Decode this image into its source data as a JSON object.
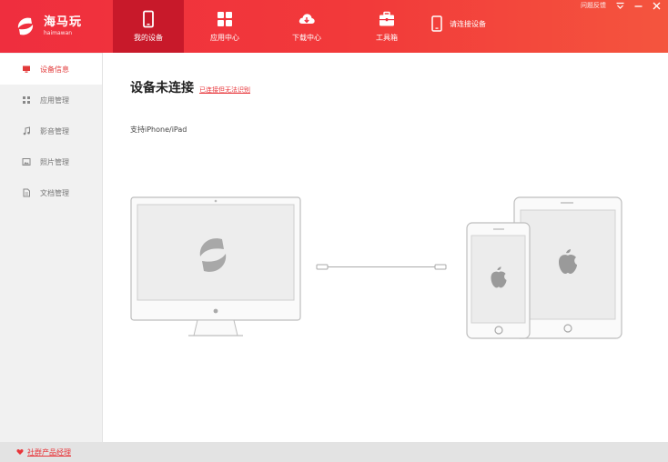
{
  "app": {
    "name": "海马玩",
    "subtitle": "haimawan"
  },
  "nav": {
    "tabs": [
      {
        "label": "我的设备",
        "icon": "phone-icon"
      },
      {
        "label": "应用中心",
        "icon": "grid-icon"
      },
      {
        "label": "下载中心",
        "icon": "cloud-download-icon"
      },
      {
        "label": "工具箱",
        "icon": "toolbox-icon"
      }
    ],
    "connect_label": "请连接设备"
  },
  "window": {
    "feedback_label": "问题反馈"
  },
  "sidebar": {
    "items": [
      {
        "label": "设备信息",
        "icon": "device-info-icon"
      },
      {
        "label": "应用管理",
        "icon": "app-grid-icon"
      },
      {
        "label": "影音管理",
        "icon": "music-note-icon"
      },
      {
        "label": "照片管理",
        "icon": "photo-icon"
      },
      {
        "label": "文档管理",
        "icon": "document-icon"
      }
    ]
  },
  "main": {
    "title": "设备未连接",
    "help_link": "已连接但无法识别",
    "support_text": "支持iPhone/iPad"
  },
  "footer": {
    "link": "社群产品经理"
  },
  "colors": {
    "brand_red": "#ef2e3e",
    "active_tab": "#c8192a",
    "sidebar_bg": "#f1f1f1",
    "link_red": "#e8353a"
  }
}
